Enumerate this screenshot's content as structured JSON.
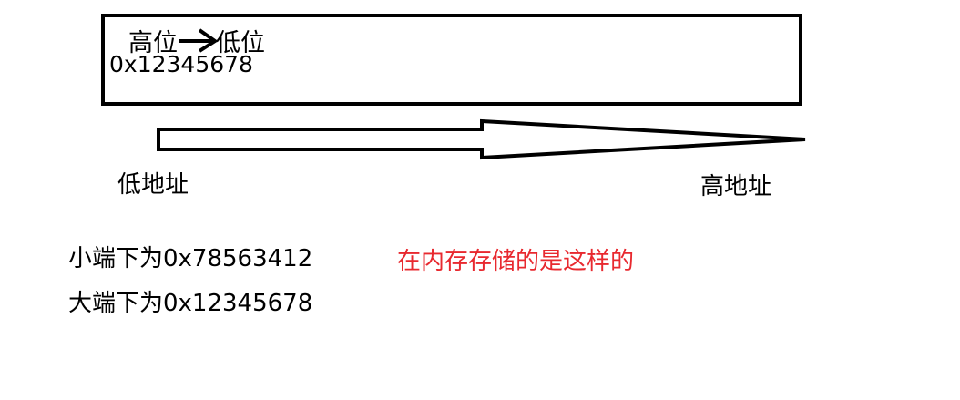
{
  "diagram": {
    "box": {
      "high_label": "高位",
      "low_label": "低位",
      "value": "0x12345678"
    },
    "addresses": {
      "low": "低地址",
      "high": "高地址"
    },
    "endianness": {
      "little": "小端下为0x78563412",
      "big": "大端下为0x12345678"
    },
    "note": "在内存存储的是这样的",
    "colors": {
      "stroke": "#000000",
      "note": "#e8292f",
      "background": "#ffffff"
    },
    "icons": {
      "box_arrow": "right-arrow-icon",
      "address_arrow": "long-right-arrow-icon"
    }
  }
}
